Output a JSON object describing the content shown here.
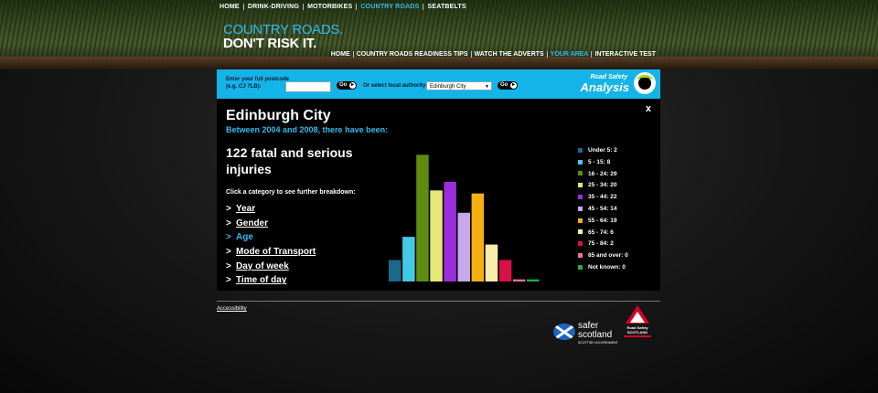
{
  "top_nav": [
    {
      "label": "HOME",
      "active": false
    },
    {
      "label": "DRINK-DRIVING",
      "active": false
    },
    {
      "label": "MOTORBIKES",
      "active": false
    },
    {
      "label": "COUNTRY ROADS",
      "active": true
    },
    {
      "label": "SEATBELTS",
      "active": false
    }
  ],
  "brand": {
    "line1": "COUNTRY ROADS.",
    "line2": "DON'T RISK IT."
  },
  "main_nav": [
    {
      "label": "HOME",
      "active": false
    },
    {
      "label": "COUNTRY ROADS READINESS TIPS",
      "active": false
    },
    {
      "label": "WATCH THE ADVERTS",
      "active": false
    },
    {
      "label": "YOUR AREA",
      "active": true
    },
    {
      "label": "INTERACTIVE TEST",
      "active": false
    }
  ],
  "search": {
    "postcode_label": "Enter your full postcode (e.g. CJ 7LB):",
    "postcode_value": "",
    "go_label": "Go",
    "authority_label": "Or select local authority:",
    "authority_value": "Edinburgh City",
    "go2_label": "Go"
  },
  "rsa": {
    "line1": "Road Safety",
    "line2": "Analysis"
  },
  "panel": {
    "close_label": "x",
    "city": "Edinburgh City",
    "subtitle": "Between 2004 and 2008, there have been:",
    "total": "122 fatal and serious injuries",
    "hint": "Click a category to see further breakdown:",
    "categories": [
      {
        "label": "Year",
        "active": false
      },
      {
        "label": "Gender",
        "active": false
      },
      {
        "label": "Age",
        "active": true
      },
      {
        "label": "Mode of Transport",
        "active": false
      },
      {
        "label": "Day of week",
        "active": false
      },
      {
        "label": "Time of day",
        "active": false
      }
    ],
    "category_marker": ">"
  },
  "chart_data": {
    "type": "bar",
    "categories": [
      "Under 5",
      "5 - 15",
      "16 - 24",
      "25 - 34",
      "35 - 44",
      "45 - 54",
      "55 - 64",
      "65 - 74",
      "75 - 84",
      "85 and over",
      "Not known"
    ],
    "values": [
      5,
      8,
      29,
      20,
      22,
      14,
      19,
      6,
      2,
      0,
      0
    ],
    "bar_heights": [
      5.0,
      10.4,
      29.5,
      21.2,
      23.2,
      16.0,
      20.5,
      8.6,
      5.0,
      0.5,
      0.5
    ],
    "colors": [
      "#1a6a8c",
      "#44c8e8",
      "#5f8c10",
      "#e8e878",
      "#9a2edc",
      "#c8a8ec",
      "#f4b010",
      "#f8eca8",
      "#d8104a",
      "#f070a8",
      "#20b048"
    ],
    "legend": [
      "Under 5: 2",
      "5 - 15: 8",
      "16 - 24: 29",
      "25 - 34: 20",
      "35 - 44: 22",
      "45 - 54: 14",
      "55 - 64: 19",
      "65 - 74: 6",
      "75 - 84: 2",
      "85 and over: 0",
      "Not known: 0"
    ],
    "ylim": [
      0,
      30
    ],
    "grid": false,
    "legend_position": "right"
  },
  "footer": {
    "accessibility_label": "Accessibility",
    "safer_line1": "safer",
    "safer_line2": "scotland",
    "safer_line3": "SCOTTISH GOVERNMENT",
    "rss_line1": "Road Safety",
    "rss_line2": "SCOTLAND"
  }
}
